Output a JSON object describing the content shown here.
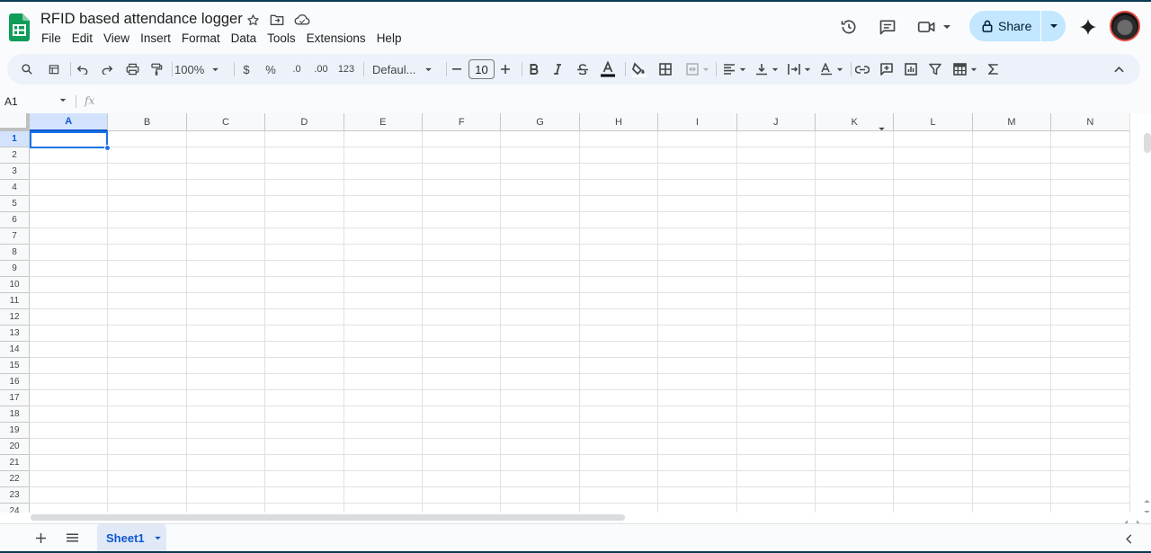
{
  "app": {
    "title": "RFID based attendance logger",
    "menus": [
      "File",
      "Edit",
      "View",
      "Insert",
      "Format",
      "Data",
      "Tools",
      "Extensions",
      "Help"
    ],
    "share_label": "Share"
  },
  "toolbar": {
    "zoom": "100%",
    "currency": "$",
    "percent": "%",
    "decrease_decimal": ".0",
    "increase_decimal": ".00",
    "number_format": "123",
    "font": "Defaul...",
    "font_size": "10",
    "icons": [
      "search-icon",
      "format-icon",
      "undo-icon",
      "redo-icon",
      "print-icon",
      "paint-format-icon",
      "bold-icon",
      "italic-icon",
      "strikethrough-icon",
      "text-color-icon",
      "fill-color-icon",
      "borders-icon",
      "merge-icon",
      "align-icon",
      "valign-icon",
      "wrap-icon",
      "rotate-icon",
      "link-icon",
      "comment-icon",
      "chart-icon",
      "filter-icon",
      "table-icon",
      "functions-icon"
    ]
  },
  "formula_bar": {
    "name_box": "A1",
    "fx": "fx",
    "value": ""
  },
  "grid": {
    "columns": [
      "A",
      "B",
      "C",
      "D",
      "E",
      "F",
      "G",
      "H",
      "I",
      "J",
      "K",
      "L",
      "M",
      "N"
    ],
    "rows": [
      "1",
      "2",
      "3",
      "4",
      "5",
      "6",
      "7",
      "8",
      "9",
      "10",
      "11",
      "12",
      "13",
      "14",
      "15",
      "16",
      "17",
      "18",
      "19",
      "20",
      "21",
      "22",
      "23",
      "24"
    ],
    "selected_cell": "A1"
  },
  "sheets": [
    "Sheet1"
  ],
  "colors": {
    "accent": "#1a73e8",
    "share_bg": "#c2e7ff",
    "logo": "#0f9d58"
  }
}
